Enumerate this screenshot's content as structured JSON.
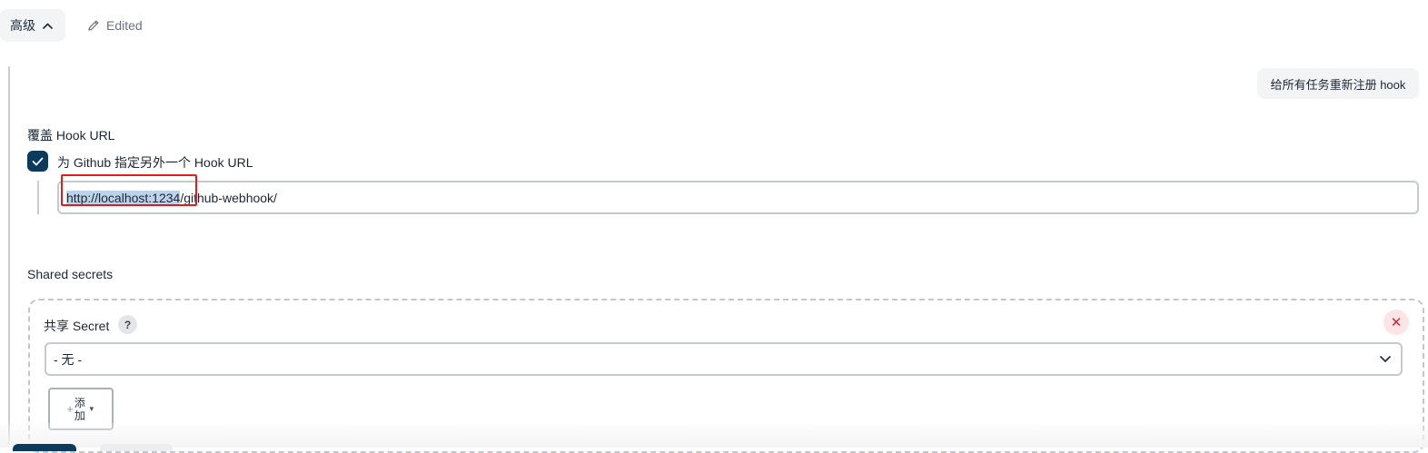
{
  "header": {
    "advanced_label": "高级",
    "edited_label": "Edited"
  },
  "actions": {
    "reregister_label": "给所有任务重新注册 hook"
  },
  "override_hook": {
    "section_label": "覆盖 Hook URL",
    "checkbox_label": "为 Github 指定另外一个 Hook URL",
    "checked": true,
    "url_selected_part": "http://localhost:1234",
    "url_rest": "/github-webhook/"
  },
  "shared_secrets": {
    "section_label": "Shared secrets",
    "secret_label": "共享 Secret",
    "help_label": "?",
    "delete_label": "✕",
    "selected_value": "- 无 -",
    "add_label_line1": "添",
    "add_label_line2": "加"
  },
  "colors": {
    "accent": "#0b3a5c",
    "highlight_box": "#e01c1c",
    "selection": "#bcd3ea"
  }
}
